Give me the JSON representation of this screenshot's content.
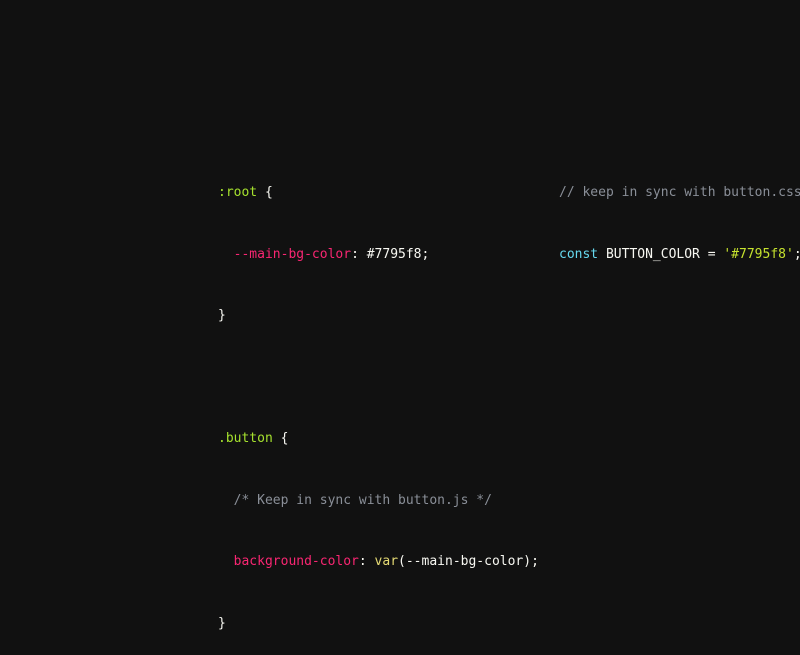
{
  "css_code": {
    "line1_selector": ":root",
    "line1_brace": " {",
    "line2_prop": "--main-bg-color",
    "line2_colon": ": ",
    "line2_value": "#7795f8;",
    "line3_brace": "}",
    "line5_selector": ".button",
    "line5_brace": " {",
    "line6_comment": "/* Keep in sync with button.js */",
    "line7_prop": "background-color",
    "line7_colon": ": ",
    "line7_fn": "var",
    "line7_args": "(--main-bg-color);",
    "line8_brace": "}"
  },
  "js_code": {
    "line1_comment": "// keep in sync with button.css",
    "line2_keyword": "const",
    "line2_name": " BUTTON_COLOR = ",
    "line2_string": "'#7795f8'",
    "line2_semi": ";"
  },
  "colors": {
    "background": "#111111",
    "selector": "#a6e22e",
    "property": "#f92672",
    "keyword": "#66d9ef",
    "comment": "#8a8f98",
    "function": "#e6db74"
  }
}
